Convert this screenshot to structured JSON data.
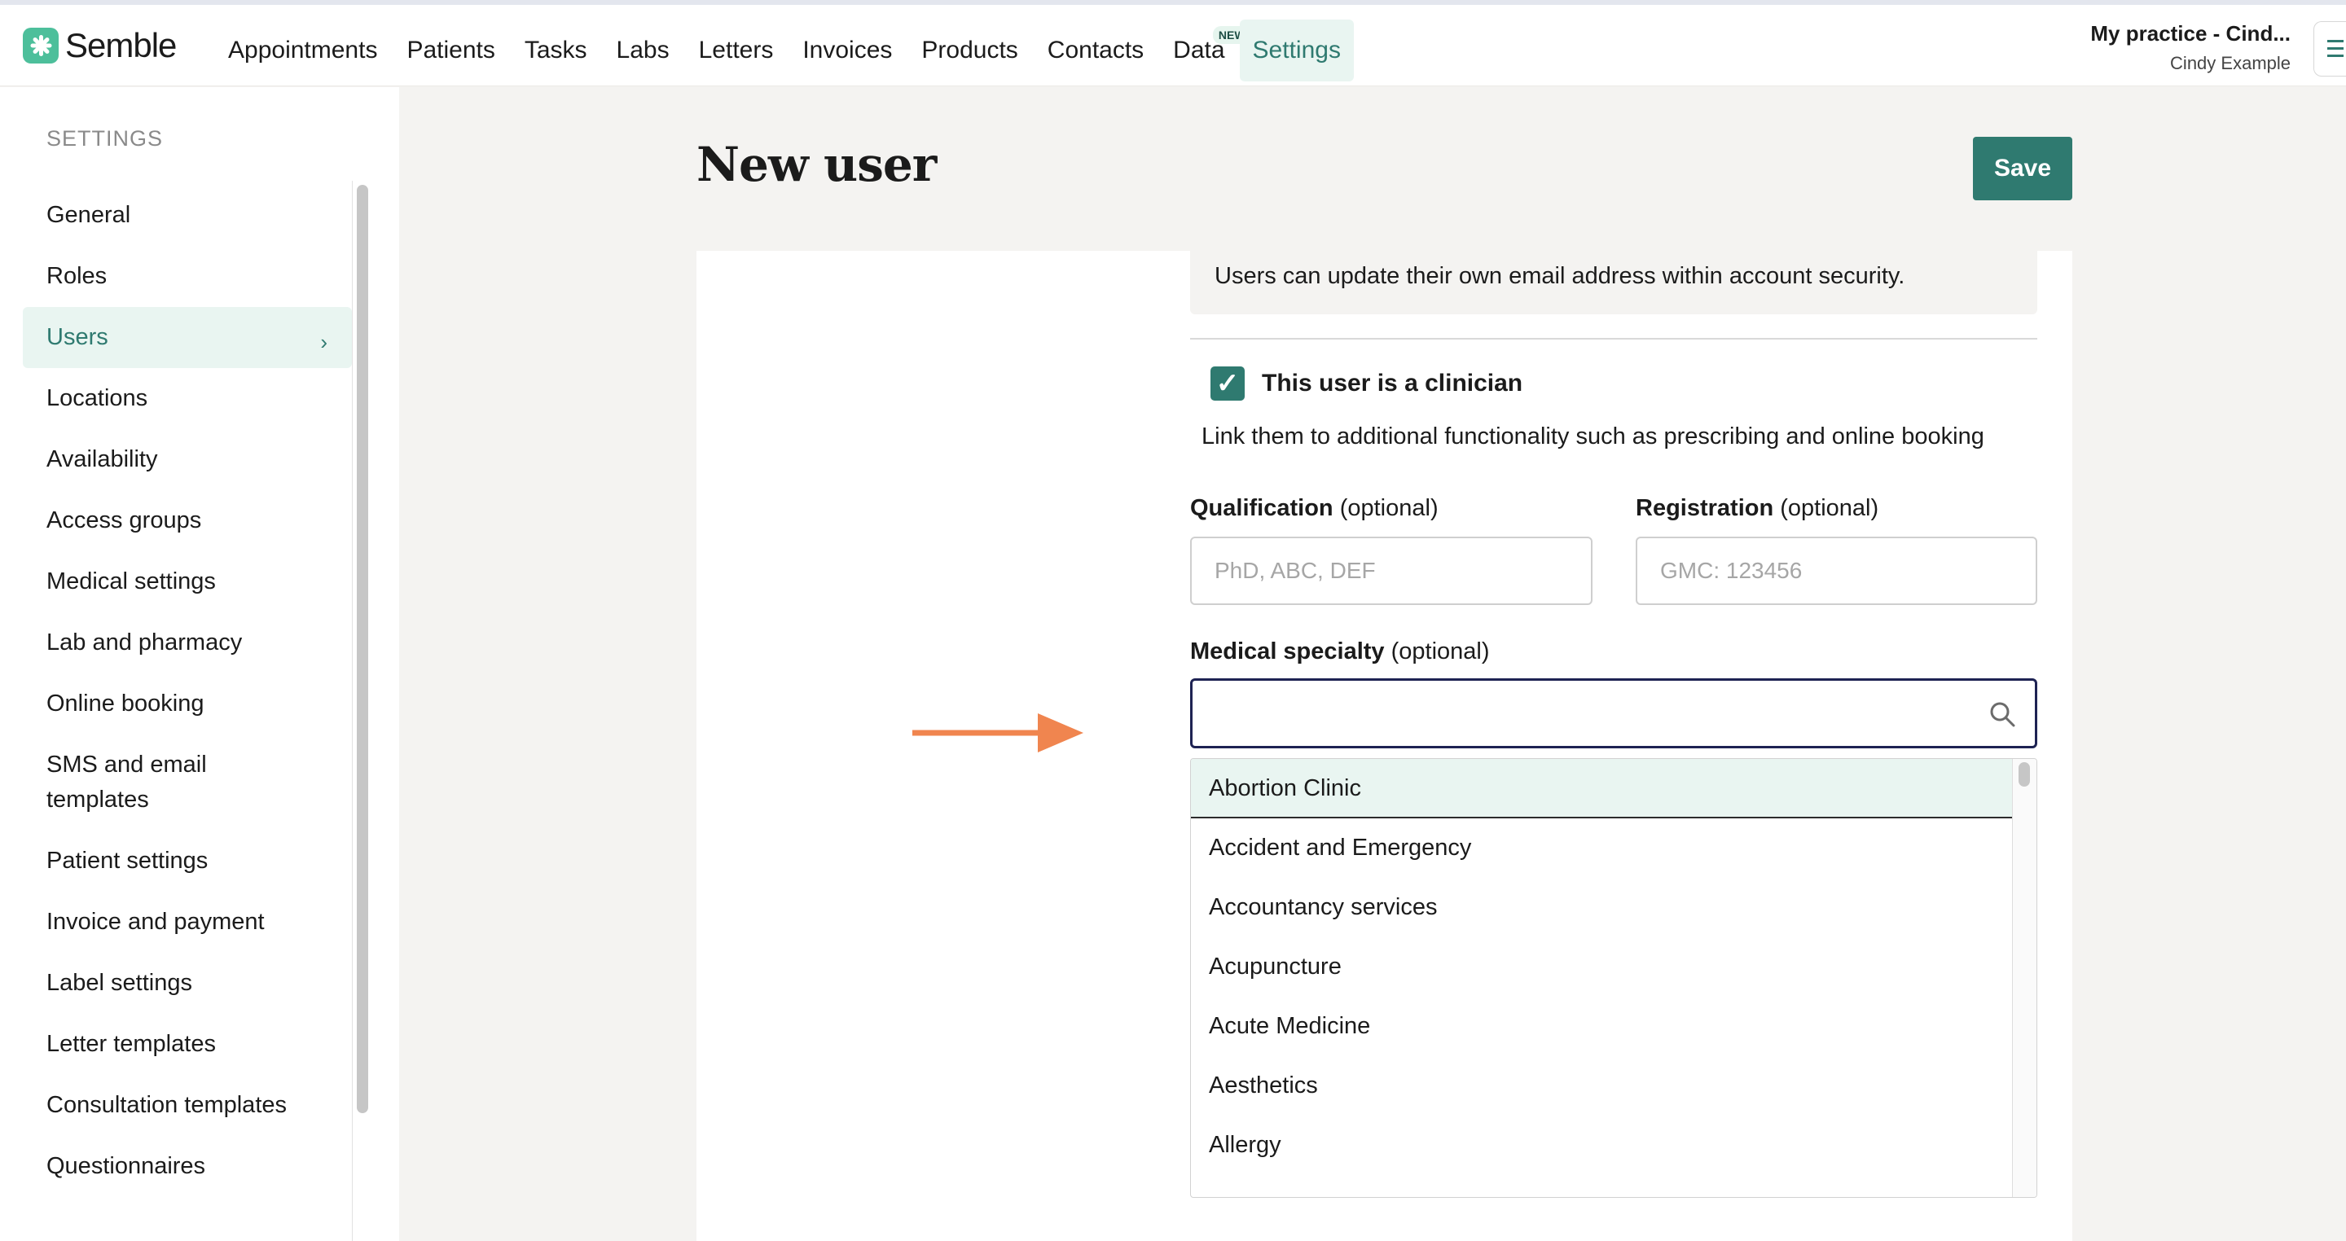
{
  "app": {
    "brand": "Semble",
    "brand_color": "#4dbf9b",
    "accent_color": "#2f7a70"
  },
  "nav": {
    "items": [
      {
        "label": "Appointments"
      },
      {
        "label": "Patients"
      },
      {
        "label": "Tasks"
      },
      {
        "label": "Labs"
      },
      {
        "label": "Letters"
      },
      {
        "label": "Invoices"
      },
      {
        "label": "Products"
      },
      {
        "label": "Contacts"
      },
      {
        "label": "Data",
        "badge": "NEW"
      },
      {
        "label": "Settings",
        "active": true
      }
    ]
  },
  "account": {
    "practice": "My practice - Cind...",
    "user": "Cindy Example",
    "menu_icon": "hamburger-icon"
  },
  "sidebar": {
    "heading": "SETTINGS",
    "items": [
      {
        "label": "General"
      },
      {
        "label": "Roles"
      },
      {
        "label": "Users",
        "active": true,
        "icon": "chevron-right-icon"
      },
      {
        "label": "Locations"
      },
      {
        "label": "Availability"
      },
      {
        "label": "Access groups"
      },
      {
        "label": "Medical settings"
      },
      {
        "label": "Lab and pharmacy"
      },
      {
        "label": "Online booking"
      },
      {
        "label": "SMS and email templates"
      },
      {
        "label": "Patient settings"
      },
      {
        "label": "Invoice and payment"
      },
      {
        "label": "Label settings"
      },
      {
        "label": "Letter templates"
      },
      {
        "label": "Consultation templates"
      },
      {
        "label": "Questionnaires"
      }
    ]
  },
  "page": {
    "title": "New user",
    "save_label": "Save"
  },
  "form": {
    "email_info": "Users can update their own email address within account security.",
    "clinician_checkbox": {
      "label": "This user is a clinician",
      "checked": true,
      "description": "Link them to additional functionality such as prescribing and online booking"
    },
    "qualification": {
      "label": "Qualification",
      "optional": "(optional)",
      "placeholder": "PhD, ABC, DEF",
      "value": ""
    },
    "registration": {
      "label": "Registration",
      "optional": "(optional)",
      "placeholder": "GMC: 123456",
      "value": ""
    },
    "medical_specialty": {
      "label": "Medical specialty",
      "optional": "(optional)",
      "value": "",
      "icon": "search-icon",
      "options": [
        "Abortion Clinic",
        "Accident and Emergency",
        "Accountancy services",
        "Acupuncture",
        "Acute Medicine",
        "Aesthetics",
        "Allergy"
      ],
      "highlighted_index": 0
    }
  },
  "annotation": {
    "arrow_icon": "arrow-right-icon",
    "arrow_color": "#f0854f"
  }
}
